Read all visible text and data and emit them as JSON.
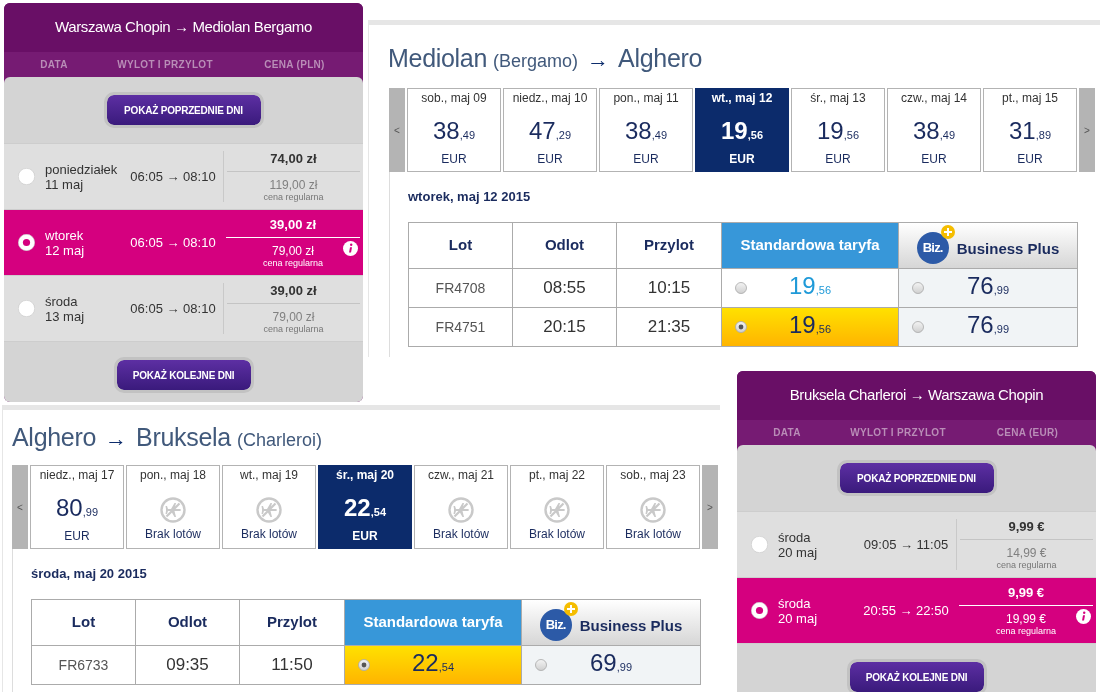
{
  "panels": [
    {
      "kind": "timetable",
      "title": "Warszawa Chopin → Mediolan Bergamo",
      "columns": [
        "DATA",
        "WYLOT I PRZYLOT",
        "CENA (PLN)"
      ],
      "prev_button": "POKAŻ POPRZEDNIE DNI",
      "rows": [
        {
          "day": "poniedziałek",
          "date": "11 maj",
          "times": "06:05 → 08:10",
          "price": "74,00 zł",
          "regular_price": "119,00 zł",
          "regular_label": "cena regularna",
          "selected": false
        },
        {
          "day": "wtorek",
          "date": "12 maj",
          "times": "06:05 → 08:10",
          "price": "39,00 zł",
          "regular_price": "79,00 zł",
          "regular_label": "cena regularna",
          "selected": true
        },
        {
          "day": "środa",
          "date": "13 maj",
          "times": "06:05 → 08:10",
          "price": "39,00 zł",
          "regular_price": "79,00 zł",
          "regular_label": "cena regularna",
          "selected": false
        }
      ],
      "next_button": "POKAŻ KOLEJNE DNI"
    },
    {
      "kind": "fare_finder",
      "title": [
        {
          "kind": "city",
          "text": "Mediolan"
        },
        {
          "kind": "airport",
          "text": "(Bergamo)"
        },
        {
          "kind": "arrow",
          "text": "→"
        },
        {
          "kind": "city",
          "text": "Alghero"
        }
      ],
      "prev": "<",
      "next": ">",
      "days": [
        {
          "kind": "fare",
          "label": "sob., maj 09",
          "price": "38",
          "cents": ",49",
          "currency": "EUR",
          "selected": false
        },
        {
          "kind": "fare",
          "label": "niedz., maj 10",
          "price": "47",
          "cents": ",29",
          "currency": "EUR",
          "selected": false
        },
        {
          "kind": "fare",
          "label": "pon., maj 11",
          "price": "38",
          "cents": ",49",
          "currency": "EUR",
          "selected": false
        },
        {
          "kind": "fare",
          "label": "wt., maj 12",
          "price": "19",
          "cents": ",56",
          "currency": "EUR",
          "selected": true
        },
        {
          "kind": "fare",
          "label": "śr., maj 13",
          "price": "19",
          "cents": ",56",
          "currency": "EUR",
          "selected": false
        },
        {
          "kind": "fare",
          "label": "czw., maj 14",
          "price": "38",
          "cents": ",49",
          "currency": "EUR",
          "selected": false
        },
        {
          "kind": "fare",
          "label": "pt., maj 15",
          "price": "31",
          "cents": ",89",
          "currency": "EUR",
          "selected": false
        }
      ],
      "date_heading": "wtorek, maj 12 2015",
      "columns": [
        {
          "kind": "text",
          "label": "Lot"
        },
        {
          "kind": "text",
          "label": "Odlot"
        },
        {
          "kind": "text",
          "label": "Przylot"
        },
        {
          "kind": "standard",
          "label": "Standardowa taryfa"
        },
        {
          "kind": "business",
          "label": "Business Plus",
          "logo": "Biz."
        }
      ],
      "flights": [
        {
          "flight": "FR4708",
          "departure": "08:55",
          "arrival": "10:15",
          "fares": [
            {
              "price": "19",
              "cents": ",56",
              "selected": false
            },
            {
              "price": "76",
              "cents": ",99",
              "selected": false
            }
          ]
        },
        {
          "flight": "FR4751",
          "departure": "20:15",
          "arrival": "21:35",
          "fares": [
            {
              "price": "19",
              "cents": ",56",
              "selected": true
            },
            {
              "price": "76",
              "cents": ",99",
              "selected": false
            }
          ]
        }
      ]
    },
    {
      "kind": "fare_finder",
      "title": [
        {
          "kind": "city",
          "text": "Alghero"
        },
        {
          "kind": "arrow",
          "text": "→"
        },
        {
          "kind": "city",
          "text": "Bruksela"
        },
        {
          "kind": "airport",
          "text": "(Charleroi)"
        }
      ],
      "prev": "<",
      "next": ">",
      "days": [
        {
          "kind": "fare",
          "label": "niedz., maj 17",
          "price": "80",
          "cents": ",99",
          "currency": "EUR",
          "selected": false
        },
        {
          "kind": "no_flights",
          "label": "pon., maj 18",
          "note": "Brak lotów",
          "selected": false
        },
        {
          "kind": "no_flights",
          "label": "wt., maj 19",
          "note": "Brak lotów",
          "selected": false
        },
        {
          "kind": "fare",
          "label": "śr., maj 20",
          "price": "22",
          "cents": ",54",
          "currency": "EUR",
          "selected": true
        },
        {
          "kind": "no_flights",
          "label": "czw., maj 21",
          "note": "Brak lotów",
          "selected": false
        },
        {
          "kind": "no_flights",
          "label": "pt., maj 22",
          "note": "Brak lotów",
          "selected": false
        },
        {
          "kind": "no_flights",
          "label": "sob., maj 23",
          "note": "Brak lotów",
          "selected": false
        }
      ],
      "date_heading": "środa, maj 20 2015",
      "columns": [
        {
          "kind": "text",
          "label": "Lot"
        },
        {
          "kind": "text",
          "label": "Odlot"
        },
        {
          "kind": "text",
          "label": "Przylot"
        },
        {
          "kind": "standard",
          "label": "Standardowa taryfa"
        },
        {
          "kind": "business",
          "label": "Business Plus",
          "logo": "Biz."
        }
      ],
      "flights": [
        {
          "flight": "FR6733",
          "departure": "09:35",
          "arrival": "11:50",
          "fares": [
            {
              "price": "22",
              "cents": ",54",
              "selected": true
            },
            {
              "price": "69",
              "cents": ",99",
              "selected": false
            }
          ]
        }
      ]
    },
    {
      "kind": "timetable",
      "title": "Bruksela Charleroi → Warszawa Chopin",
      "columns": [
        "DATA",
        "WYLOT I PRZYLOT",
        "CENA (EUR)"
      ],
      "prev_button": "POKAŻ POPRZEDNIE DNI",
      "rows": [
        {
          "day": "środa",
          "date": "20 maj",
          "times": "09:05 → 11:05",
          "price": "9,99 €",
          "regular_price": "14,99 €",
          "regular_label": "cena regularna",
          "selected": false
        },
        {
          "day": "środa",
          "date": "20 maj",
          "times": "20:55 → 22:50",
          "price": "9,99 €",
          "regular_price": "19,99 €",
          "regular_label": "cena regularna",
          "selected": true
        }
      ],
      "next_button": "POKAŻ KOLEJNE DNI"
    }
  ]
}
